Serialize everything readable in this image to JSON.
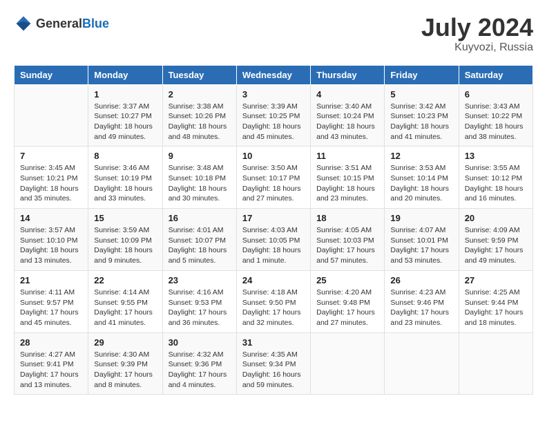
{
  "header": {
    "logo_general": "General",
    "logo_blue": "Blue",
    "title": "July 2024",
    "location": "Kuyvozi, Russia"
  },
  "weekdays": [
    "Sunday",
    "Monday",
    "Tuesday",
    "Wednesday",
    "Thursday",
    "Friday",
    "Saturday"
  ],
  "weeks": [
    [
      {
        "day": "",
        "sunrise": "",
        "sunset": "",
        "daylight": ""
      },
      {
        "day": "1",
        "sunrise": "Sunrise: 3:37 AM",
        "sunset": "Sunset: 10:27 PM",
        "daylight": "Daylight: 18 hours and 49 minutes."
      },
      {
        "day": "2",
        "sunrise": "Sunrise: 3:38 AM",
        "sunset": "Sunset: 10:26 PM",
        "daylight": "Daylight: 18 hours and 48 minutes."
      },
      {
        "day": "3",
        "sunrise": "Sunrise: 3:39 AM",
        "sunset": "Sunset: 10:25 PM",
        "daylight": "Daylight: 18 hours and 45 minutes."
      },
      {
        "day": "4",
        "sunrise": "Sunrise: 3:40 AM",
        "sunset": "Sunset: 10:24 PM",
        "daylight": "Daylight: 18 hours and 43 minutes."
      },
      {
        "day": "5",
        "sunrise": "Sunrise: 3:42 AM",
        "sunset": "Sunset: 10:23 PM",
        "daylight": "Daylight: 18 hours and 41 minutes."
      },
      {
        "day": "6",
        "sunrise": "Sunrise: 3:43 AM",
        "sunset": "Sunset: 10:22 PM",
        "daylight": "Daylight: 18 hours and 38 minutes."
      }
    ],
    [
      {
        "day": "7",
        "sunrise": "Sunrise: 3:45 AM",
        "sunset": "Sunset: 10:21 PM",
        "daylight": "Daylight: 18 hours and 35 minutes."
      },
      {
        "day": "8",
        "sunrise": "Sunrise: 3:46 AM",
        "sunset": "Sunset: 10:19 PM",
        "daylight": "Daylight: 18 hours and 33 minutes."
      },
      {
        "day": "9",
        "sunrise": "Sunrise: 3:48 AM",
        "sunset": "Sunset: 10:18 PM",
        "daylight": "Daylight: 18 hours and 30 minutes."
      },
      {
        "day": "10",
        "sunrise": "Sunrise: 3:50 AM",
        "sunset": "Sunset: 10:17 PM",
        "daylight": "Daylight: 18 hours and 27 minutes."
      },
      {
        "day": "11",
        "sunrise": "Sunrise: 3:51 AM",
        "sunset": "Sunset: 10:15 PM",
        "daylight": "Daylight: 18 hours and 23 minutes."
      },
      {
        "day": "12",
        "sunrise": "Sunrise: 3:53 AM",
        "sunset": "Sunset: 10:14 PM",
        "daylight": "Daylight: 18 hours and 20 minutes."
      },
      {
        "day": "13",
        "sunrise": "Sunrise: 3:55 AM",
        "sunset": "Sunset: 10:12 PM",
        "daylight": "Daylight: 18 hours and 16 minutes."
      }
    ],
    [
      {
        "day": "14",
        "sunrise": "Sunrise: 3:57 AM",
        "sunset": "Sunset: 10:10 PM",
        "daylight": "Daylight: 18 hours and 13 minutes."
      },
      {
        "day": "15",
        "sunrise": "Sunrise: 3:59 AM",
        "sunset": "Sunset: 10:09 PM",
        "daylight": "Daylight: 18 hours and 9 minutes."
      },
      {
        "day": "16",
        "sunrise": "Sunrise: 4:01 AM",
        "sunset": "Sunset: 10:07 PM",
        "daylight": "Daylight: 18 hours and 5 minutes."
      },
      {
        "day": "17",
        "sunrise": "Sunrise: 4:03 AM",
        "sunset": "Sunset: 10:05 PM",
        "daylight": "Daylight: 18 hours and 1 minute."
      },
      {
        "day": "18",
        "sunrise": "Sunrise: 4:05 AM",
        "sunset": "Sunset: 10:03 PM",
        "daylight": "Daylight: 17 hours and 57 minutes."
      },
      {
        "day": "19",
        "sunrise": "Sunrise: 4:07 AM",
        "sunset": "Sunset: 10:01 PM",
        "daylight": "Daylight: 17 hours and 53 minutes."
      },
      {
        "day": "20",
        "sunrise": "Sunrise: 4:09 AM",
        "sunset": "Sunset: 9:59 PM",
        "daylight": "Daylight: 17 hours and 49 minutes."
      }
    ],
    [
      {
        "day": "21",
        "sunrise": "Sunrise: 4:11 AM",
        "sunset": "Sunset: 9:57 PM",
        "daylight": "Daylight: 17 hours and 45 minutes."
      },
      {
        "day": "22",
        "sunrise": "Sunrise: 4:14 AM",
        "sunset": "Sunset: 9:55 PM",
        "daylight": "Daylight: 17 hours and 41 minutes."
      },
      {
        "day": "23",
        "sunrise": "Sunrise: 4:16 AM",
        "sunset": "Sunset: 9:53 PM",
        "daylight": "Daylight: 17 hours and 36 minutes."
      },
      {
        "day": "24",
        "sunrise": "Sunrise: 4:18 AM",
        "sunset": "Sunset: 9:50 PM",
        "daylight": "Daylight: 17 hours and 32 minutes."
      },
      {
        "day": "25",
        "sunrise": "Sunrise: 4:20 AM",
        "sunset": "Sunset: 9:48 PM",
        "daylight": "Daylight: 17 hours and 27 minutes."
      },
      {
        "day": "26",
        "sunrise": "Sunrise: 4:23 AM",
        "sunset": "Sunset: 9:46 PM",
        "daylight": "Daylight: 17 hours and 23 minutes."
      },
      {
        "day": "27",
        "sunrise": "Sunrise: 4:25 AM",
        "sunset": "Sunset: 9:44 PM",
        "daylight": "Daylight: 17 hours and 18 minutes."
      }
    ],
    [
      {
        "day": "28",
        "sunrise": "Sunrise: 4:27 AM",
        "sunset": "Sunset: 9:41 PM",
        "daylight": "Daylight: 17 hours and 13 minutes."
      },
      {
        "day": "29",
        "sunrise": "Sunrise: 4:30 AM",
        "sunset": "Sunset: 9:39 PM",
        "daylight": "Daylight: 17 hours and 8 minutes."
      },
      {
        "day": "30",
        "sunrise": "Sunrise: 4:32 AM",
        "sunset": "Sunset: 9:36 PM",
        "daylight": "Daylight: 17 hours and 4 minutes."
      },
      {
        "day": "31",
        "sunrise": "Sunrise: 4:35 AM",
        "sunset": "Sunset: 9:34 PM",
        "daylight": "Daylight: 16 hours and 59 minutes."
      },
      {
        "day": "",
        "sunrise": "",
        "sunset": "",
        "daylight": ""
      },
      {
        "day": "",
        "sunrise": "",
        "sunset": "",
        "daylight": ""
      },
      {
        "day": "",
        "sunrise": "",
        "sunset": "",
        "daylight": ""
      }
    ]
  ]
}
